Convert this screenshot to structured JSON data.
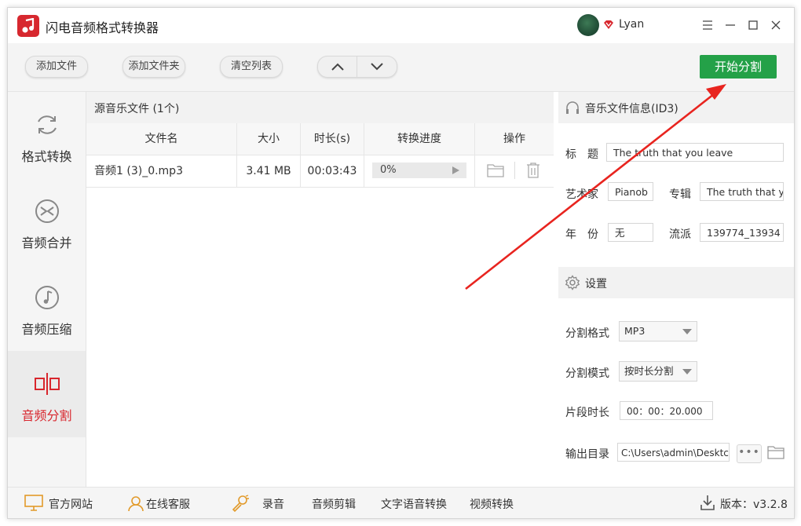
{
  "app": {
    "title": "闪电音频格式转换器",
    "user": "Lyan"
  },
  "toolbar": {
    "add_file": "添加文件",
    "add_folder": "添加文件夹",
    "clear_list": "清空列表",
    "start": "开始分割",
    "start_color": "#24a148"
  },
  "sidebar": {
    "items": [
      {
        "label": "格式转换",
        "icon": "refresh-icon"
      },
      {
        "label": "音频合并",
        "icon": "merge-icon"
      },
      {
        "label": "音频压缩",
        "icon": "music-note-icon"
      },
      {
        "label": "音频分割",
        "icon": "split-icon",
        "active": true
      }
    ],
    "active_color": "#d8262d"
  },
  "file_list": {
    "header": "源音乐文件 (1个)",
    "columns": [
      "文件名",
      "大小",
      "时长(s)",
      "转换进度",
      "操作"
    ],
    "rows": [
      {
        "name": "音频1 (3)_0.mp3",
        "size": "3.41 MB",
        "duration": "00:03:43",
        "progress": "0%",
        "progress_value": 0
      }
    ]
  },
  "id3": {
    "header": "音乐文件信息(ID3)",
    "title_label": "标　题",
    "title_value": "The truth that you leave",
    "artist_label": "艺术家",
    "artist_value": "Pianob",
    "album_label": "专辑",
    "album_value": "The truth that y",
    "year_label": "年　份",
    "year_value": "无",
    "genre_label": "流派",
    "genre_value": "139774_13934"
  },
  "settings": {
    "header": "设置",
    "format_label": "分割格式",
    "format_value": "MP3",
    "mode_label": "分割模式",
    "mode_value": "按时长分割",
    "duration_label": "片段时长",
    "duration_value": "00：00：20.000",
    "output_label": "输出目录",
    "output_value": "C:\\Users\\admin\\Desktc",
    "browse_label": "•••"
  },
  "footer": {
    "website": "官方网站",
    "support": "在线客服",
    "record": "录音",
    "edit": "音频剪辑",
    "tts": "文字语音转换",
    "video": "视频转换",
    "version": "版本：v3.2.8"
  },
  "annotation_color": "#e8241f"
}
